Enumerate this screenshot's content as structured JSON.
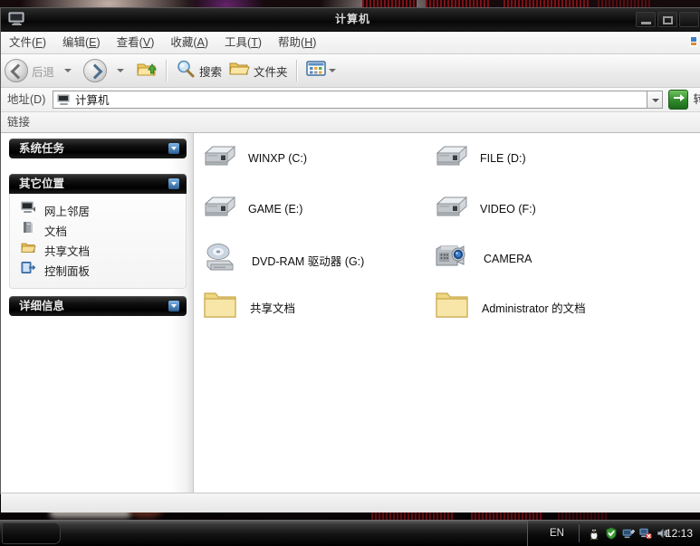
{
  "window": {
    "title": "计算机",
    "title_icon": "computer-icon",
    "buttons": {
      "minimize": "minimize-button",
      "maximize": "maximize-button",
      "close": "close-button"
    }
  },
  "menubar": {
    "items": [
      {
        "label": "文件(",
        "key": "F",
        "tail": ")"
      },
      {
        "label": "编辑(",
        "key": "E",
        "tail": ")"
      },
      {
        "label": "查看(",
        "key": "V",
        "tail": ")"
      },
      {
        "label": "收藏(",
        "key": "A",
        "tail": ")"
      },
      {
        "label": "工具(",
        "key": "T",
        "tail": ")"
      },
      {
        "label": "帮助(",
        "key": "H",
        "tail": ")"
      }
    ]
  },
  "toolbar": {
    "back_label": "后退",
    "forward_label": "",
    "up_label": "",
    "search_label": "搜索",
    "folders_label": "文件夹",
    "views_label": ""
  },
  "address": {
    "label": "地址(D)",
    "value": "计算机",
    "icon": "computer-icon",
    "go_label": "转"
  },
  "links": {
    "label": "链接"
  },
  "sidebar": {
    "panels": [
      {
        "title": "系统任务",
        "items": []
      },
      {
        "title": "其它位置",
        "items": [
          {
            "label": "网上邻居",
            "icon": "network-icon"
          },
          {
            "label": "文档",
            "icon": "documents-icon"
          },
          {
            "label": "共享文档",
            "icon": "shared-folder-icon"
          },
          {
            "label": "控制面板",
            "icon": "control-panel-icon"
          }
        ]
      },
      {
        "title": "详细信息",
        "items": []
      }
    ]
  },
  "content": {
    "items": [
      {
        "label": "WINXP (C:)",
        "icon": "hard-drive-icon"
      },
      {
        "label": "FILE (D:)",
        "icon": "hard-drive-icon"
      },
      {
        "label": "GAME (E:)",
        "icon": "hard-drive-icon"
      },
      {
        "label": "VIDEO (F:)",
        "icon": "hard-drive-icon"
      },
      {
        "label": "DVD-RAM 驱动器 (G:)",
        "icon": "optical-drive-icon"
      },
      {
        "label": "CAMERA",
        "icon": "camera-icon"
      },
      {
        "label": "共享文档",
        "icon": "folder-icon"
      },
      {
        "label": "Administrator 的文档",
        "icon": "folder-icon"
      }
    ]
  },
  "taskbar": {
    "start_label": "",
    "language": "EN",
    "clock": "12:13",
    "tray_icons": [
      "penguin-icon",
      "shield-icon",
      "network-activity-icon",
      "network-error-icon",
      "volume-icon"
    ]
  },
  "colors": {
    "panel_header": "#000000",
    "accent_blue": "#2b5e93",
    "go_green": "#2f8a2a",
    "drive_grey": "#b9bec4",
    "folder_yellow": "#f5d97a"
  }
}
